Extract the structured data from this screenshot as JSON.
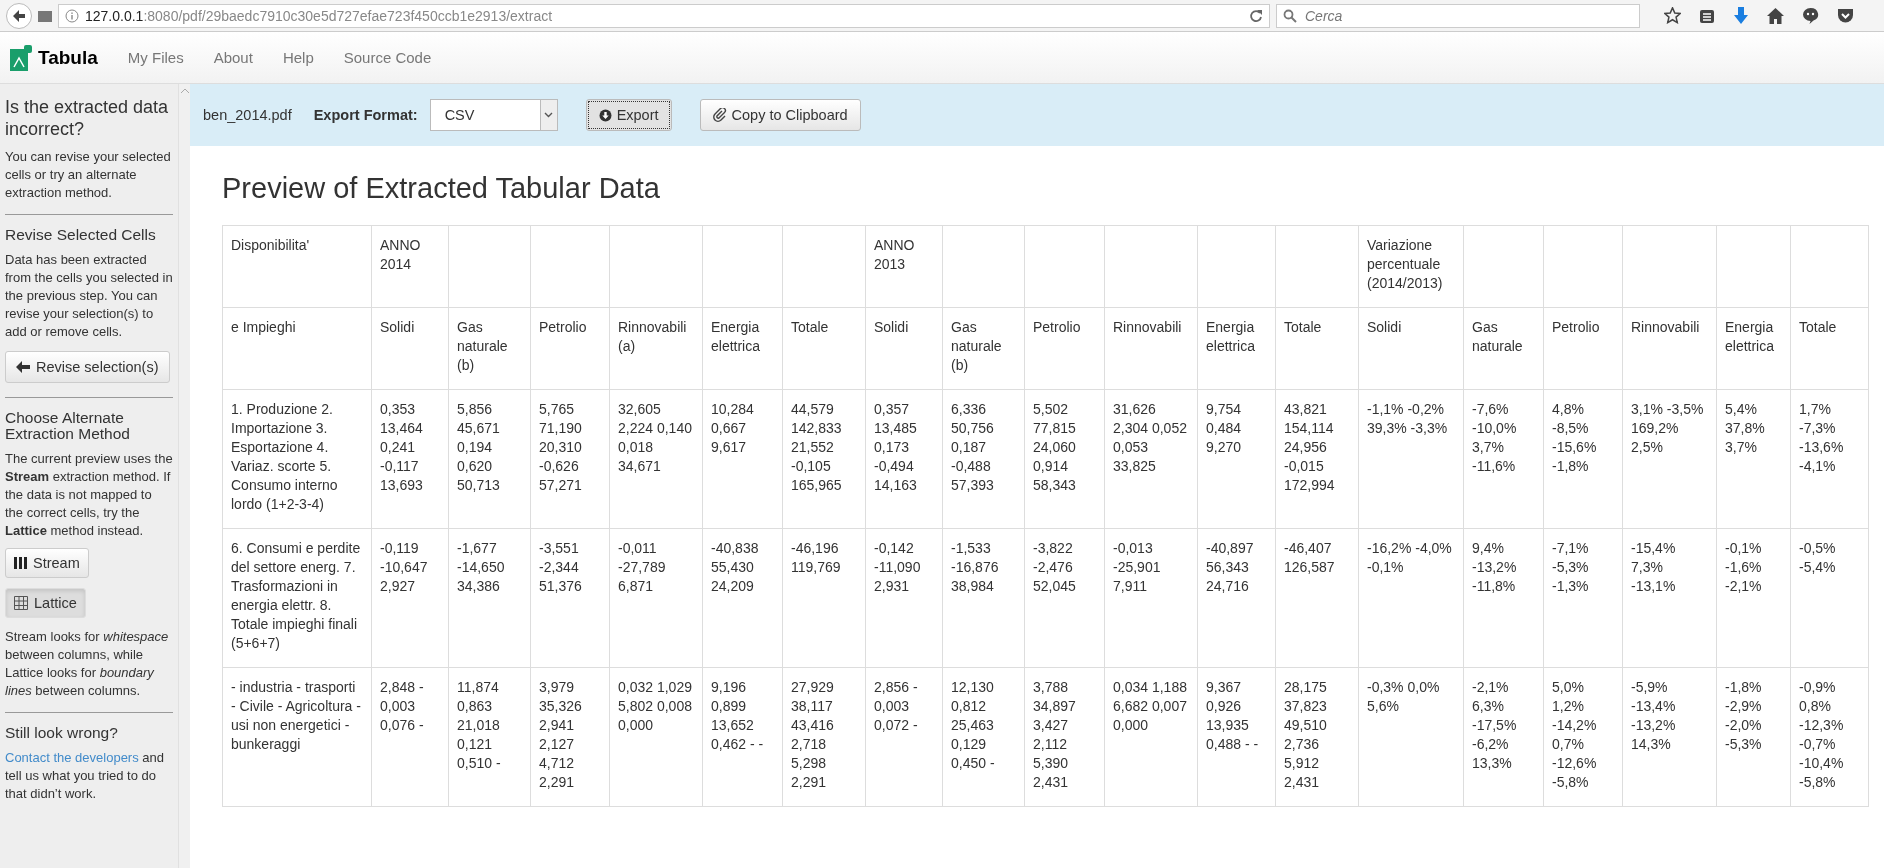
{
  "browser": {
    "url_host": "127.0.0.1",
    "url_path": ":8080/pdf/29baedc7910c30e5d727efae723f450ccb1e2913/extract",
    "search": {
      "placeholder": "Cerca"
    }
  },
  "navbar": {
    "brand": "Tabula",
    "links": [
      "My Files",
      "About",
      "Help",
      "Source Code"
    ]
  },
  "sidebar": {
    "title": "Is the extracted data incorrect?",
    "intro": "You can revise your selected cells or try an alternate extraction method.",
    "revise": {
      "heading": "Revise Selected Cells",
      "text": "Data has been extracted from the cells you selected in the previous step. You can revise your selection(s) to add or remove cells.",
      "button": "Revise selection(s)"
    },
    "method": {
      "heading": "Choose Alternate Extraction Method",
      "text": "The current preview uses the **Stream** extraction method. If the data is not mapped to the correct cells, try the **Lattice** method instead.",
      "buttons": [
        {
          "label": "Stream",
          "kind": "stream",
          "selected": false
        },
        {
          "label": "Lattice",
          "kind": "lattice",
          "selected": true
        }
      ],
      "note": "Stream looks for *whitespace* between columns, while Lattice looks for *boundary lines* between columns."
    },
    "help": {
      "heading": "Still look wrong?",
      "link": "Contact the developers",
      "text": " and tell us what you tried to do that didn’t work."
    }
  },
  "toolbar": {
    "filename": "ben_2014.pdf",
    "format_label": "Export Format:",
    "format_value": "CSV",
    "export_button": "Export",
    "copy_button": "Copy to Clipboard"
  },
  "title": "Preview of Extracted Tabular Data",
  "table": {
    "rows": [
      [
        "Disponibilita'",
        "ANNO 2014",
        null,
        null,
        null,
        null,
        null,
        "ANNO 2013",
        null,
        null,
        null,
        null,
        null,
        "Variazione percentuale (2014/2013)",
        null,
        null,
        null,
        null,
        null
      ],
      [
        "e Impieghi",
        "Solidi",
        "Gas naturale (b)",
        "Petrolio",
        "Rinnovabili (a)",
        "Energia elettrica",
        "Totale",
        "Solidi",
        "Gas naturale (b)",
        "Petrolio",
        "Rinnovabili",
        "Energia elettrica",
        "Totale",
        "Solidi",
        "Gas naturale",
        "Petrolio",
        "Rinnovabili",
        "Energia elettrica",
        "Totale"
      ],
      [
        "1. Produzione 2. Importazione 3. Esportazione 4. Variaz. scorte 5. Consumo interno lordo (1+2-3-4)",
        "0,353 13,464 0,241 -0,117 13,693",
        "5,856 45,671 0,194 0,620 50,713",
        "5,765 71,190 20,310 -0,626 57,271",
        "32,605 2,224 0,140 0,018 34,671",
        "10,284 0,667 9,617",
        "44,579 142,833 21,552 -0,105 165,965",
        "0,357 13,485 0,173 -0,494 14,163",
        "6,336 50,756 0,187 -0,488 57,393",
        "5,502 77,815 24,060 0,914 58,343",
        "31,626 2,304 0,052 0,053 33,825",
        "9,754 0,484 9,270",
        "43,821 154,114 24,956 -0,015 172,994",
        "-1,1% -0,2% 39,3% -3,3%",
        "-7,6% -10,0% 3,7% -11,6%",
        "4,8% -8,5% -15,6% -1,8%",
        "3,1% -3,5% 169,2% 2,5%",
        "5,4% 37,8% 3,7%",
        "1,7% -7,3% -13,6% -4,1%"
      ],
      [
        "6. Consumi e perdite del settore energ. 7. Trasformazioni in energia elettr. 8. Totale impieghi finali (5+6+7)",
        "-0,119 -10,647 2,927",
        "-1,677 -14,650 34,386",
        "-3,551 -2,344 51,376",
        "-0,011 -27,789 6,871",
        "-40,838 55,430 24,209",
        "-46,196 119,769",
        "-0,142 -11,090 2,931",
        "-1,533 -16,876 38,984",
        "-3,822 -2,476 52,045",
        "-0,013 -25,901 7,911",
        "-40,897 56,343 24,716",
        "-46,407 126,587",
        "-16,2% -4,0% -0,1%",
        "9,4% -13,2% -11,8%",
        "-7,1% -5,3% -1,3%",
        "-15,4% 7,3% -13,1%",
        "-0,1% -1,6% -2,1%",
        "-0,5% -5,4%"
      ],
      [
        "- industria - trasporti - Civile - Agricoltura - usi non energetici - bunkeraggi",
        "2,848 - 0,003 0,076 -",
        "11,874 0,863 21,018 0,121 0,510 -",
        "3,979 35,326 2,941 2,127 4,712 2,291",
        "0,032 1,029 5,802 0,008 0,000",
        "9,196 0,899 13,652 0,462 - -",
        "27,929 38,117 43,416 2,718 5,298 2,291",
        "2,856 - 0,003 0,072 -",
        "12,130 0,812 25,463 0,129 0,450 -",
        "3,788 34,897 3,427 2,112 5,390 2,431",
        "0,034 1,188 6,682 0,007 0,000",
        "9,367 0,926 13,935 0,488 - -",
        "28,175 37,823 49,510 2,736 5,912 2,431",
        "-0,3% 0,0% 5,6%",
        "-2,1% 6,3% -17,5% -6,2% 13,3%",
        "5,0% 1,2% -14,2% 0,7% -12,6% -5,8%",
        "-5,9% -13,4% -13,2% 14,3%",
        "-1,8% -2,9% -2,0% -5,3%",
        "-0,9% 0,8% -12,3% -0,7% -10,4% -5,8%"
      ]
    ]
  }
}
